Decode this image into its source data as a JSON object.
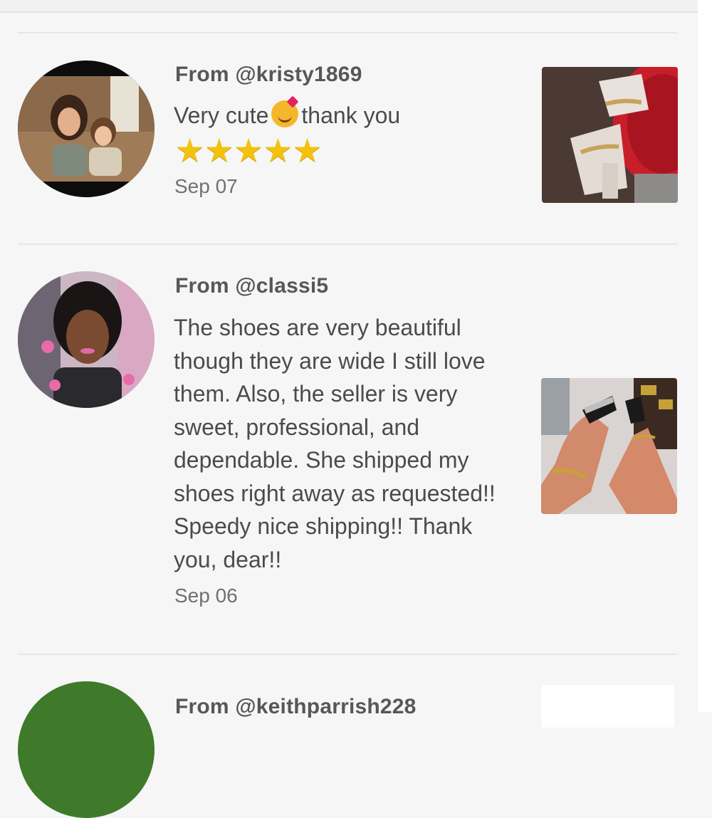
{
  "reviews": [
    {
      "from": "From @kristy1869",
      "text_before": "Very cute",
      "emoji": "smiling-face-with-hearts-icon",
      "text_after": "thank you",
      "rating": 5,
      "date": "Sep 07"
    },
    {
      "from": "From @classi5",
      "text": "The shoes are very beautiful though they are wide I still love them. Also, the seller is very sweet, professional, and dependable. She shipped my shoes right away as requested!! Speedy nice shipping!! Thank you, dear!!",
      "date": "Sep 06"
    },
    {
      "from": "From @keithparrish228"
    }
  ],
  "colors": {
    "background": "#f6f6f6",
    "star": "#f4c20d",
    "divider": "#e6e6e6"
  }
}
